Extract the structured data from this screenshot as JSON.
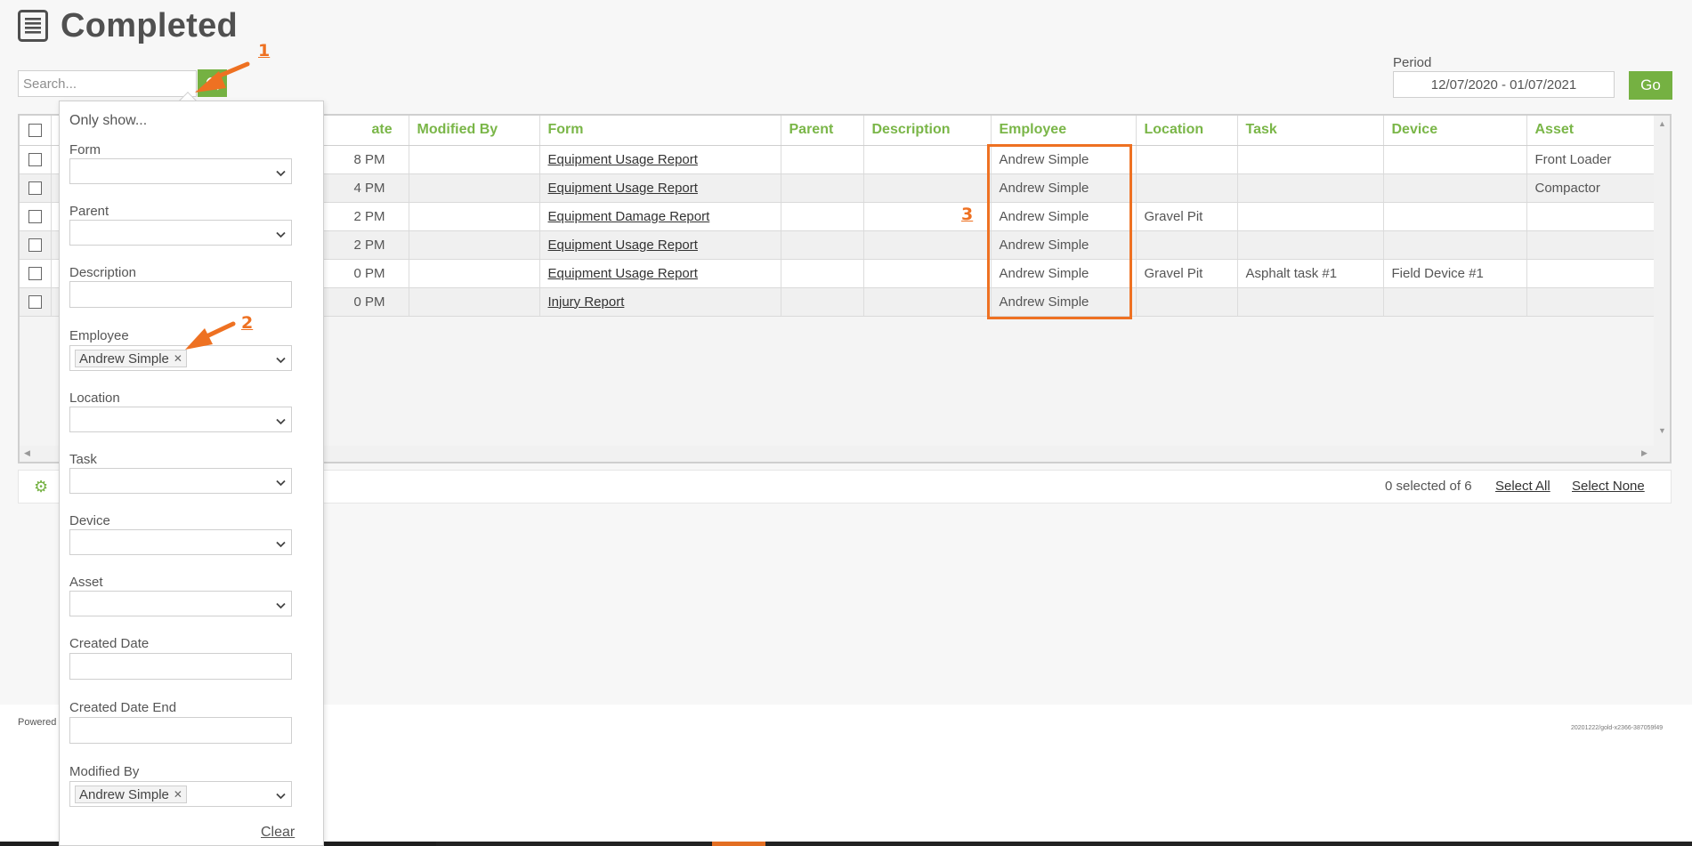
{
  "page": {
    "title": "Completed",
    "icon": "document-list-icon"
  },
  "search": {
    "placeholder": "Search...",
    "dropdown_icon": "chevron-down-icon",
    "button_icon": "search-icon"
  },
  "period": {
    "label": "Period",
    "value": "12/07/2020 - 01/07/2021",
    "go_label": "Go"
  },
  "table": {
    "columns": [
      "",
      "ate",
      "Modified By",
      "Form",
      "Parent",
      "Description",
      "Employee",
      "Location",
      "Task",
      "Device",
      "Asset"
    ],
    "rows": [
      {
        "date": "8 PM",
        "modified_by": "",
        "form": "Equipment Usage Report",
        "parent": "",
        "description": "",
        "employee": "Andrew Simple",
        "location": "",
        "task": "",
        "device": "",
        "asset": "Front Loader"
      },
      {
        "date": "4 PM",
        "modified_by": "",
        "form": "Equipment Usage Report",
        "parent": "",
        "description": "",
        "employee": "Andrew Simple",
        "location": "",
        "task": "",
        "device": "",
        "asset": "Compactor"
      },
      {
        "date": "2 PM",
        "modified_by": "",
        "form": "Equipment Damage Report",
        "parent": "",
        "description": "",
        "employee": "Andrew Simple",
        "location": "Gravel Pit",
        "task": "",
        "device": "",
        "asset": ""
      },
      {
        "date": "2 PM",
        "modified_by": "",
        "form": "Equipment Usage Report",
        "parent": "",
        "description": "",
        "employee": "Andrew Simple",
        "location": "",
        "task": "",
        "device": "",
        "asset": ""
      },
      {
        "date": "0 PM",
        "modified_by": "",
        "form": "Equipment Usage Report",
        "parent": "",
        "description": "",
        "employee": "Andrew Simple",
        "location": "Gravel Pit",
        "task": "Asphalt task #1",
        "device": "Field Device #1",
        "asset": ""
      },
      {
        "date": "0 PM",
        "modified_by": "",
        "form": "Injury Report",
        "parent": "",
        "description": "",
        "employee": "Andrew Simple",
        "location": "",
        "task": "",
        "device": "",
        "asset": ""
      }
    ]
  },
  "footer": {
    "selected_text": "0 selected of 6",
    "select_all": "Select All",
    "select_none": "Select None",
    "settings_icon": "gear-icon"
  },
  "filter_panel": {
    "heading": "Only show...",
    "fields": {
      "form": "Form",
      "parent": "Parent",
      "description": "Description",
      "employee": "Employee",
      "location": "Location",
      "task": "Task",
      "device": "Device",
      "asset": "Asset",
      "created_date": "Created Date",
      "created_date_end": "Created Date End",
      "modified_by": "Modified By"
    },
    "employee_tag": "Andrew Simple",
    "modified_by_tag": "Andrew Simple",
    "clear": "Clear"
  },
  "annotations": {
    "n1": "1",
    "n2": "2",
    "n3": "3"
  },
  "bottom": {
    "powered": "Powered",
    "version": "20201222/gold-x2366-387059f49"
  },
  "colors": {
    "accent": "#75b142",
    "header_text": "#7ab648",
    "annotation": "#ee7122"
  }
}
